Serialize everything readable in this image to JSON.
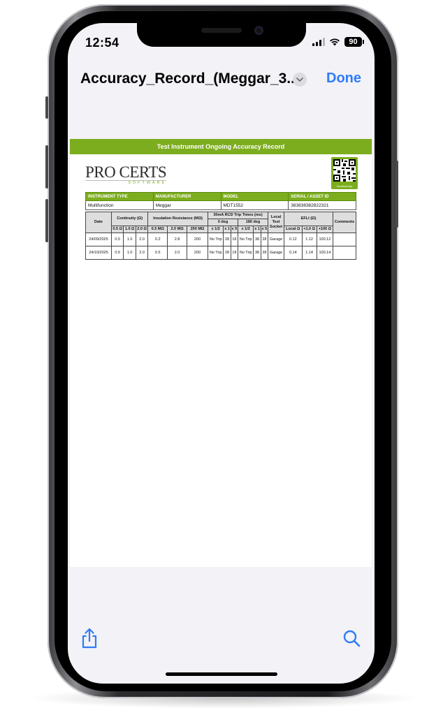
{
  "status": {
    "time": "12:54",
    "battery": "90"
  },
  "nav": {
    "title": "Accuracy_Record_(Meggar_3...",
    "done": "Done"
  },
  "doc": {
    "header": "Test Instrument Ongoing Accuracy Record",
    "logo_main": "PRO CERTS",
    "logo_sub": "SOFTWARE",
    "qr_label": "Download App",
    "info_headers": [
      "INSTRUMENT TYPE",
      "MANUFACTURER",
      "MODEL",
      "SERIAL / ASSET ID"
    ],
    "info_values": [
      "Multifunction",
      "Meggar",
      "MDT1552",
      "383838382822321"
    ],
    "grid": {
      "date": "Date",
      "continuity": "Continuity (Ω)",
      "insulation": "Insulation Resistance (MΩ)",
      "rcd": "30mA RCD Trip Times (ms)",
      "deg0": "0 deg",
      "deg180": "180 deg",
      "efli": "EFLI (Ω)",
      "comments": "Comments",
      "local_test_socket": "Local Test Socket",
      "sub": {
        "c05": "0.5 Ω",
        "c10": "1.0 Ω",
        "c20": "2.0 Ω",
        "i05": "0.5 MΩ",
        "i20": "2.0 MΩ",
        "i200": "200 MΩ",
        "x12a": "x 1/2",
        "x1a": "x 1",
        "x5a": "x 5",
        "x12b": "x 1/2",
        "x1b": "x 1",
        "x5b": "x 5",
        "local": "Local Ω",
        "p10": "+1.0 Ω",
        "p100": "+100 Ω"
      },
      "rows": [
        {
          "date": "24/09/2025",
          "c05": "0.5",
          "c10": "1.0",
          "c20": "2.0",
          "i05": "0.2",
          "i20": "2.8",
          "i200": "200",
          "x12a": "No Trip",
          "x1a": "28",
          "x5a": "18",
          "x12b": "No Trip",
          "x1b": "38",
          "x5b": "28",
          "socket": "Garage",
          "local": "0.12",
          "p10": "1.12",
          "p100": "100.12",
          "comments": ""
        },
        {
          "date": "24/10/2025",
          "c05": "0.5",
          "c10": "1.0",
          "c20": "2.0",
          "i05": "0.5",
          "i20": "2.0",
          "i200": "200",
          "x12a": "No Trip",
          "x1a": "28",
          "x5a": "18",
          "x12b": "No Trip",
          "x1b": "38",
          "x5b": "28",
          "socket": "Garage",
          "local": "0.14",
          "p10": "1.14",
          "p100": "100.14",
          "comments": ""
        }
      ]
    }
  },
  "toolbar": {
    "share_icon": "share-icon",
    "search_icon": "search-icon"
  },
  "colors": {
    "accent": "#2f7cf6",
    "brand_green": "#7cad1e"
  }
}
